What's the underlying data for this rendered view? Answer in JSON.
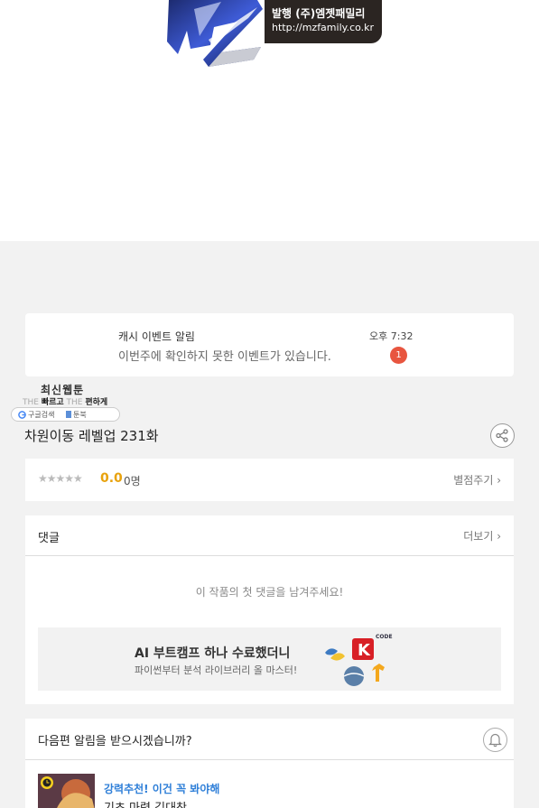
{
  "publisher": {
    "logo_text": "MZ",
    "line1": "발행 (주)엠젯패밀리",
    "line2": "http://mzfamily.co.kr"
  },
  "notification": {
    "title": "캐시 이벤트 알림",
    "body": "이번주에 확인하지 못한 이벤트가 있습니다.",
    "time": "오후 7:32",
    "badge": "1"
  },
  "webtoon_badge": {
    "title": "최신웹툰",
    "tag_the1": "THE",
    "tag_fast": "빠르고",
    "tag_the2": "THE",
    "tag_easy": "편하게",
    "pill_search": "구글검색",
    "pill_name": "툰북"
  },
  "episode": {
    "title": "차원이동 레벨업 231화"
  },
  "rating": {
    "stars": "★★★★★",
    "score": "0.0",
    "count": "0명",
    "link": "별점주기 ›"
  },
  "comments": {
    "title": "댓글",
    "more": "더보기 ›",
    "empty": "이 작품의 첫 댓글을 남겨주세요!"
  },
  "ad": {
    "title": "AI 부트캠프 하나 수료했더니",
    "subtitle": "파이썬부터 분석 라이브러리 올 마스터!",
    "mini_logo": "CODE"
  },
  "alert": {
    "title": "다음편 알림을 받으시겠습니까?"
  },
  "recommend": {
    "tag": "강력추천! 이건 꼭 봐야해",
    "title": "기초 마력 김대찬"
  },
  "colors": {
    "accent_orange": "#e8a20c",
    "badge_red": "#e8553f",
    "link_blue": "#2f7fd8",
    "bg_gray": "#f2f2f2"
  }
}
